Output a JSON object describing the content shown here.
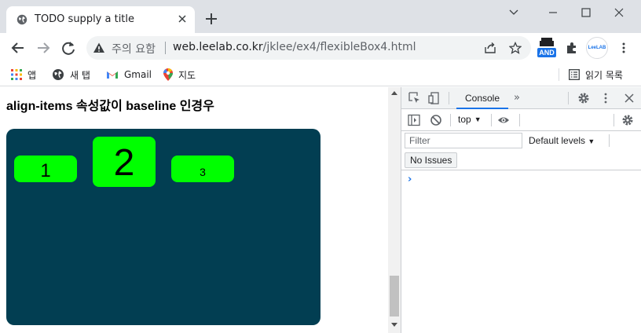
{
  "browser": {
    "tab": {
      "title": "TODO supply a title"
    },
    "omnibox": {
      "security_label": "주의 요함",
      "url_host": "web.leelab.co.kr",
      "url_path": "/jklee/ex4/flexibleBox4.html"
    },
    "extensions": {
      "and_badge": "AND",
      "leelab_label": "LeeLAB"
    },
    "bookmarks": [
      {
        "label": "앱",
        "icon": "apps-grid-icon"
      },
      {
        "label": "새 탭",
        "icon": "globe-icon"
      },
      {
        "label": "Gmail",
        "icon": "gmail-icon"
      },
      {
        "label": "지도",
        "icon": "maps-pin-icon"
      }
    ],
    "reading_list": "읽기 목록"
  },
  "page": {
    "heading": "align-items 속성값이 baseline 인경우",
    "items": [
      "1",
      "2",
      "3"
    ],
    "colors": {
      "container": "#023e52",
      "item": "#00ff00"
    }
  },
  "devtools": {
    "console_tab": "Console",
    "context": "top",
    "filter_placeholder": "Filter",
    "levels": "Default levels",
    "issues_button": "No Issues",
    "prompt": "›"
  }
}
